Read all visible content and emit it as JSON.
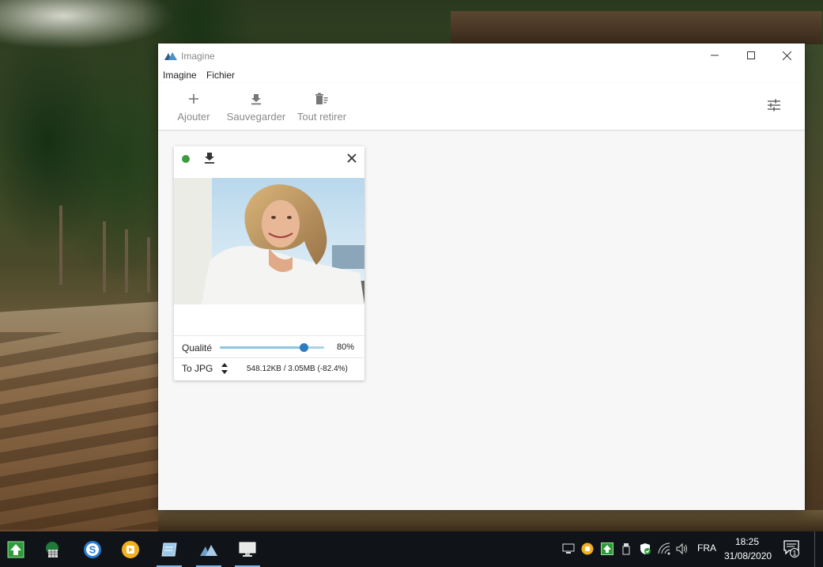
{
  "window": {
    "title": "Imagine"
  },
  "menu": {
    "items": [
      "Imagine",
      "Fichier"
    ]
  },
  "toolbar": {
    "add_label": "Ajouter",
    "save_label": "Sauvegarder",
    "clear_label": "Tout retirer",
    "add_icon": "plus-icon",
    "save_icon": "download-icon",
    "clear_icon": "trash-list-icon",
    "settings_icon": "sliders-icon"
  },
  "card": {
    "status": "done",
    "status_color": "#3f9b3f",
    "quality_label": "Qualité",
    "quality_value": "80%",
    "quality": 0.8,
    "format_label": "To JPG",
    "size_info": "548.12KB / 3.05MB (-82.4%)"
  },
  "taskbar": {
    "apps": [
      "green-arrow-app-icon",
      "spreadsheet-app-icon",
      "s-circle-app-icon",
      "yellow-media-app-icon",
      "notepad-app-icon",
      "imagine-app-icon",
      "monitor-app-icon"
    ],
    "language": "FRA",
    "time": "18:25",
    "date": "31/08/2020",
    "notification_count": "1"
  },
  "colors": {
    "accent": "#2e7cc0",
    "slider_track": "#a9d4e8",
    "taskbar_bg": "#101418"
  }
}
